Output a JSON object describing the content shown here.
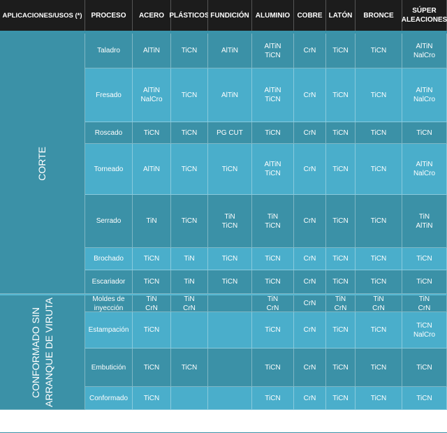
{
  "header": [
    "APLICACIONES/USOS (*)",
    "PROCESO",
    "ACERO",
    "PLÁSTICOS",
    "FUNDICIÓN",
    "ALUMINIO",
    "COBRE",
    "LATÓN",
    "BRONCE",
    "SÚPER\nALEACIONES"
  ],
  "groups": [
    {
      "name": "CORTE",
      "rows": [
        {
          "process": "Taladro",
          "values": [
            "AlTiN",
            "TiCN",
            "AlTiN",
            "AlTiN\nTiCN",
            "CrN",
            "TiCN",
            "TiCN",
            "AlTiN\nNalCro"
          ]
        },
        {
          "process": "Fresado",
          "values": [
            "AlTiN\nNalCro",
            "TiCN",
            "AlTiN",
            "AlTiN\nTiCN",
            "CrN",
            "TiCN",
            "TiCN",
            "AlTiN\nNalCro"
          ]
        },
        {
          "process": "Roscado",
          "values": [
            "TiCN",
            "TiCN",
            "PG CUT",
            "TiCN",
            "CrN",
            "TiCN",
            "TiCN",
            "TiCN"
          ]
        },
        {
          "process": "Torneado",
          "values": [
            "AlTiN",
            "TiCN",
            "TiCN",
            "AlTiN\nTiCN",
            "CrN",
            "TiCN",
            "TiCN",
            "AlTiN\nNalCro"
          ]
        },
        {
          "process": "Serrado",
          "values": [
            "TiN",
            "TiCN",
            "TiN\nTiCN",
            "TiN\nTiCN",
            "CrN",
            "TiCN",
            "TiCN",
            "TiN\nAlTiN"
          ]
        },
        {
          "process": "Brochado",
          "values": [
            "TiCN",
            "TiN",
            "TiCN",
            "TiCN",
            "CrN",
            "TiCN",
            "TiCN",
            "TiCN"
          ]
        },
        {
          "process": "Escariador",
          "values": [
            "TiCN",
            "TiN",
            "TiCN",
            "TiCN",
            "CrN",
            "TiCN",
            "TiCN",
            "TiCN"
          ]
        }
      ]
    },
    {
      "name": "CONFORMADO SIN\nARRANQUE DE VIRUTA",
      "rows": [
        {
          "process": "Moldes de\ninyección",
          "values": [
            "TiN\nCrN",
            "TiN\nCrN",
            "",
            "TiN\nCrN",
            "CrN",
            "TiN\nCrN",
            "TiN\nCrN",
            "TiN\nCrN"
          ]
        },
        {
          "process": "Estampación",
          "values": [
            "TiCN",
            "",
            "",
            "TiCN",
            "CrN",
            "TiCN",
            "TiCN",
            "TiCN\nNalCro"
          ]
        },
        {
          "process": "Embutición",
          "values": [
            "TiCN",
            "TiCN",
            "",
            "TiCN",
            "CrN",
            "TiCN",
            "TiCN",
            "TiCN"
          ]
        },
        {
          "process": "Conformado",
          "values": [
            "TiCN",
            "",
            "",
            "TiCN",
            "CrN",
            "TiCN",
            "TiCN",
            "TiCN"
          ]
        }
      ]
    }
  ],
  "colors": {
    "header_bg": "#1c1c1c",
    "row_dark": "#3b91a7",
    "row_light": "#4aaecb",
    "separator": "#56b8d2"
  }
}
